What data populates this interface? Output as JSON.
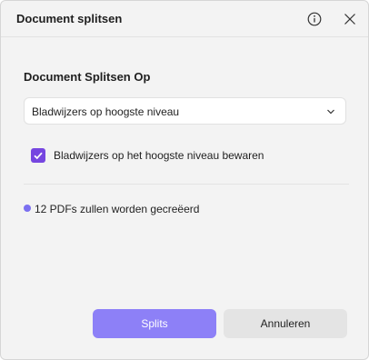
{
  "window": {
    "title": "Document splitsen"
  },
  "section": {
    "title": "Document Splitsen Op"
  },
  "split_select": {
    "value": "Bladwijzers op hoogste niveau"
  },
  "keep_bookmarks": {
    "label": "Bladwijzers op het hoogste niveau bewaren",
    "checked": true
  },
  "status": {
    "text": "12 PDFs zullen worden gecreëerd"
  },
  "buttons": {
    "split_label": "Splits",
    "cancel_label": "Annuleren"
  },
  "colors": {
    "accent": "#7646e0",
    "primary_button": "#8d80f7",
    "status_dot": "#7b6ff0"
  },
  "icons": {
    "info": "info-icon",
    "close": "close-icon",
    "chevron": "chevron-down-icon",
    "check": "check-icon"
  }
}
